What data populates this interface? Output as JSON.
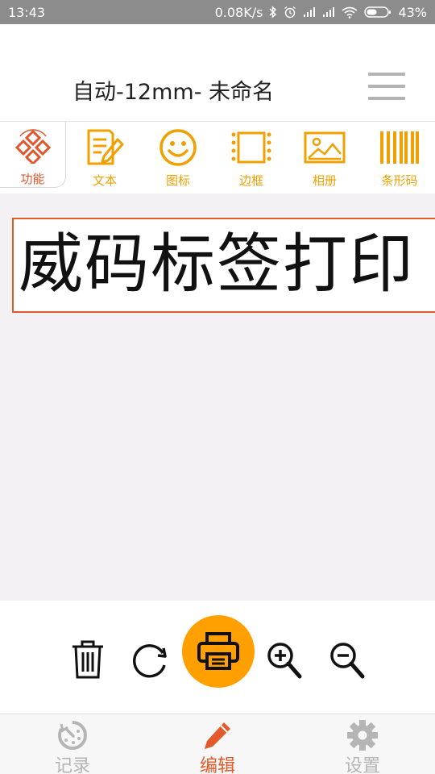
{
  "status_bar": {
    "time": "13:43",
    "net_speed": "0.08K/s",
    "battery": "43%"
  },
  "header": {
    "title": "自动-12mm- 未命名"
  },
  "toolbar": {
    "items": [
      {
        "label": "功能",
        "icon": "function-icon"
      },
      {
        "label": "文本",
        "icon": "text-icon"
      },
      {
        "label": "图标",
        "icon": "smiley-icon"
      },
      {
        "label": "边框",
        "icon": "border-icon"
      },
      {
        "label": "相册",
        "icon": "album-icon"
      },
      {
        "label": "条形码",
        "icon": "barcode-icon"
      }
    ]
  },
  "canvas": {
    "label_text": "威码标签打印"
  },
  "actions": [
    {
      "name": "delete",
      "icon": "trash-icon"
    },
    {
      "name": "rotate",
      "icon": "rotate-icon"
    },
    {
      "name": "print",
      "icon": "printer-icon"
    },
    {
      "name": "zoom-in",
      "icon": "zoom-in-icon"
    },
    {
      "name": "zoom-out",
      "icon": "zoom-out-icon"
    }
  ],
  "bottom_nav": {
    "items": [
      {
        "label": "记录",
        "icon": "record-icon",
        "active": false
      },
      {
        "label": "编辑",
        "icon": "pencil-icon",
        "active": true
      },
      {
        "label": "设置",
        "icon": "gear-icon",
        "active": false
      }
    ]
  },
  "colors": {
    "accent_orange": "#ffa000",
    "accent_red": "#e25a2a",
    "inactive_gray": "#b5b5b5"
  }
}
